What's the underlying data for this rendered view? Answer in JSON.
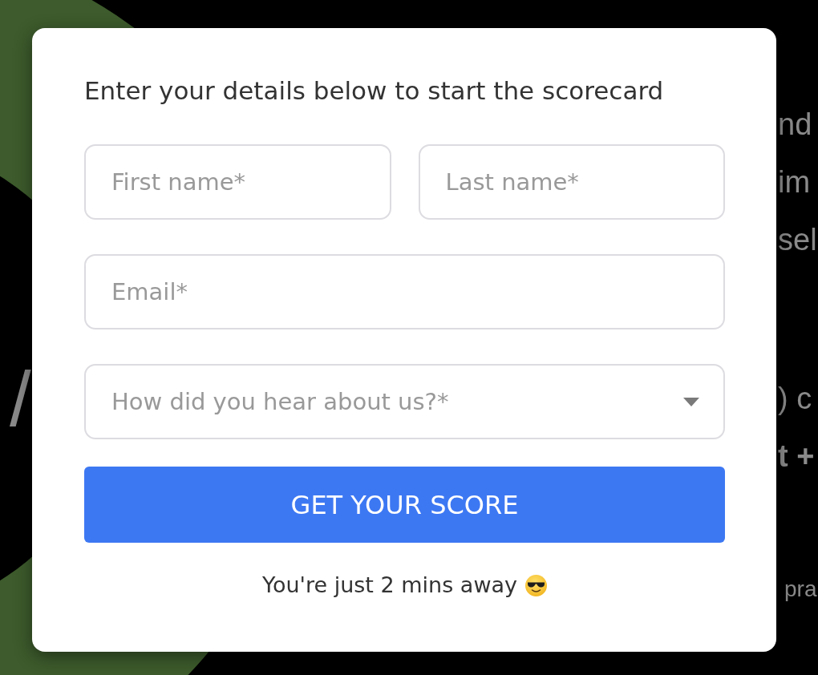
{
  "background": {
    "left_text": "/",
    "paragraphs": [
      {
        "kind": "regular",
        "lines": [
          {
            "text": "nd",
            "bold": false
          },
          {
            "text": "im",
            "bold": false
          },
          {
            "text": "sel",
            "bold": false
          }
        ]
      },
      {
        "kind": "regular",
        "lines": [
          {
            "text": ") c",
            "bold": false
          },
          {
            "text": "t +",
            "bold": true
          }
        ]
      },
      {
        "kind": "small",
        "lines": [
          {
            "text": "pra",
            "bold": false
          }
        ]
      }
    ]
  },
  "form": {
    "heading": "Enter your details below to start the scorecard",
    "rows": [
      {
        "fields": [
          {
            "kind": "text",
            "placeholder": "First name*"
          },
          {
            "kind": "text",
            "placeholder": "Last name*"
          }
        ]
      },
      {
        "fields": [
          {
            "kind": "text",
            "placeholder": "Email*"
          }
        ]
      },
      {
        "fields": [
          {
            "kind": "select",
            "placeholder": "How did you hear about us?*"
          }
        ]
      }
    ],
    "submit_button": "GET YOUR SCORE",
    "footer_note": "You're just 2 mins away"
  }
}
